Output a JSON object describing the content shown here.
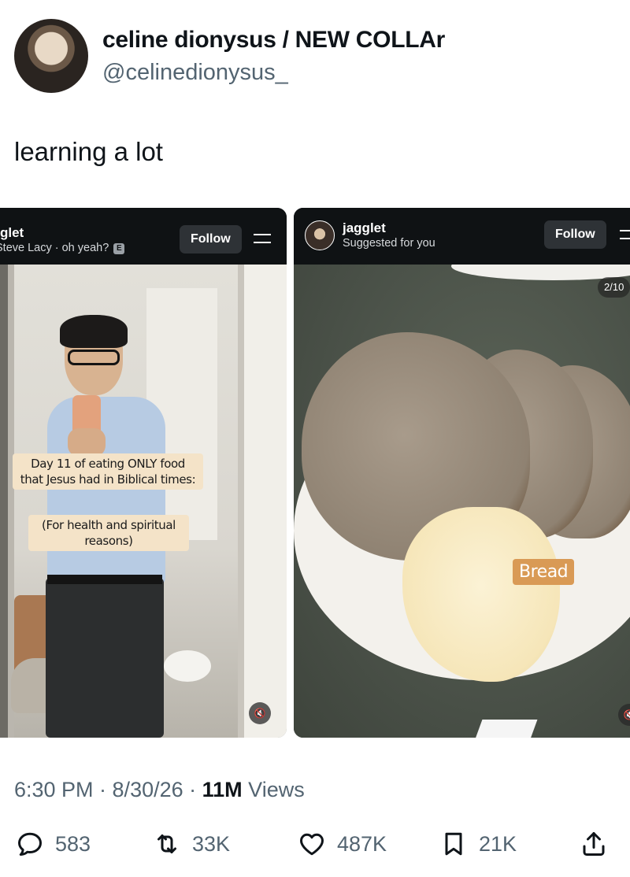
{
  "author": {
    "display_name": "celine dionysus / NEW COLLAr",
    "handle": "@celinedionysus_"
  },
  "tweet": {
    "text": "learning a lot"
  },
  "media": {
    "left": {
      "account": "glet",
      "audio": "Steve Lacy · oh yeah?",
      "explicit_badge": "E",
      "follow_label": "Follow",
      "caption_1": "Day 11 of eating ONLY food that Jesus had in Biblical times:",
      "caption_2": "(For health and spiritual reasons)"
    },
    "right": {
      "account": "jagglet",
      "subtitle": "Suggested for you",
      "follow_label": "Follow",
      "counter": "2/10",
      "food_tag": "Bread"
    }
  },
  "meta": {
    "time_date": "6:30 PM · 8/30/26 · ",
    "views_count": "11M",
    "views_label": " Views"
  },
  "stats": {
    "replies": "583",
    "reposts": "33K",
    "likes": "487K",
    "bookmarks": "21K"
  }
}
